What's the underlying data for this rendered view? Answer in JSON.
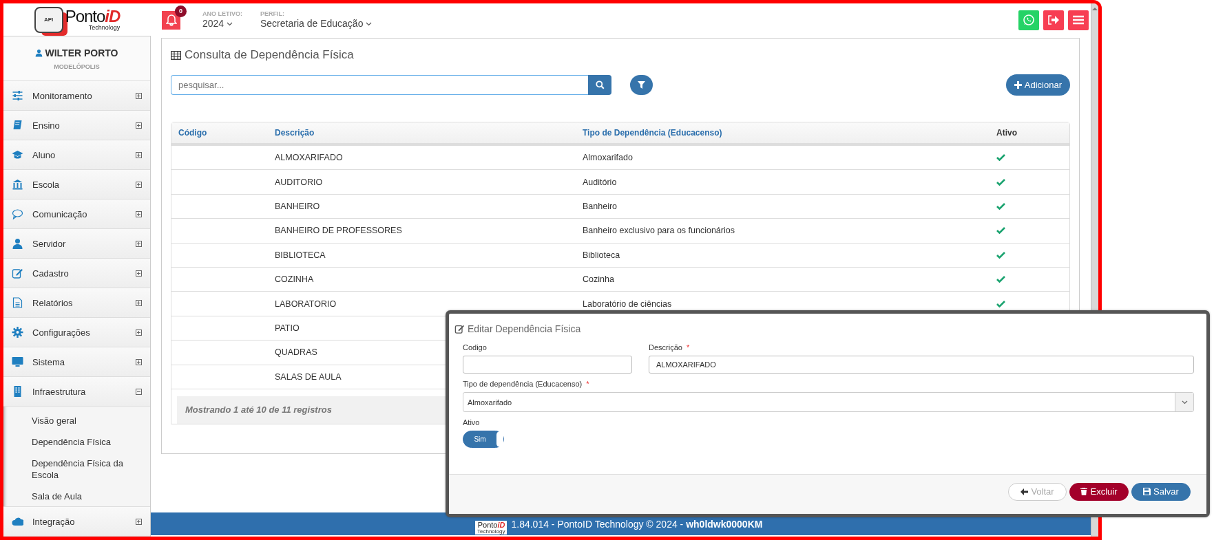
{
  "header": {
    "logo": {
      "badge": "API",
      "name": "Ponto",
      "accent": "iD",
      "tagline": "Technology"
    },
    "notifications": "0",
    "year": {
      "label": "ANO LETIVO:",
      "value": "2024"
    },
    "profile": {
      "label": "PERFIL:",
      "value": "Secretaria de Educação"
    }
  },
  "sidebar": {
    "user": "WILTER PORTO",
    "city": "MODELÓPOLIS",
    "items": [
      {
        "label": "Monitoramento",
        "expanded": false
      },
      {
        "label": "Ensino",
        "expanded": false
      },
      {
        "label": "Aluno",
        "expanded": false
      },
      {
        "label": "Escola",
        "expanded": false
      },
      {
        "label": "Comunicação",
        "expanded": false
      },
      {
        "label": "Servidor",
        "expanded": false
      },
      {
        "label": "Cadastro",
        "expanded": false
      },
      {
        "label": "Relatórios",
        "expanded": false
      },
      {
        "label": "Configurações",
        "expanded": false
      },
      {
        "label": "Sistema",
        "expanded": false
      },
      {
        "label": "Infraestrutura",
        "expanded": true,
        "children": [
          {
            "label": "Visão geral"
          },
          {
            "label": "Dependência Física"
          },
          {
            "label": "Dependência Física da Escola"
          },
          {
            "label": "Sala de Aula"
          }
        ]
      },
      {
        "label": "Integração",
        "expanded": false
      }
    ]
  },
  "page": {
    "title": "Consulta de Dependência Física",
    "search": {
      "placeholder": "pesquisar..."
    },
    "add_button": "Adicionar"
  },
  "table": {
    "columns": [
      "Código",
      "Descrição",
      "Tipo de Dependência (Educacenso)",
      "Ativo"
    ],
    "rows": [
      {
        "description": "ALMOXARIFADO",
        "type": "Almoxarifado",
        "active": true
      },
      {
        "description": "AUDITORIO",
        "type": "Auditório",
        "active": true
      },
      {
        "description": "BANHEIRO",
        "type": "Banheiro",
        "active": true
      },
      {
        "description": "BANHEIRO DE PROFESSORES",
        "type": "Banheiro exclusivo para os funcionários",
        "active": true
      },
      {
        "description": "BIBLIOTECA",
        "type": "Biblioteca",
        "active": true
      },
      {
        "description": "COZINHA",
        "type": "Cozinha",
        "active": true
      },
      {
        "description": "LABORATORIO",
        "type": "Laboratório de ciências",
        "active": true
      },
      {
        "description": "PATIO"
      },
      {
        "description": "QUADRAS"
      },
      {
        "description": "SALAS DE AULA"
      }
    ],
    "summary": "Mostrando **1** até **10** de **11** registros"
  },
  "footer": {
    "logo": {
      "name": "Ponto",
      "accent": "iD",
      "tagline": "Technology"
    },
    "text": "1.84.014 - PontoID Technology © 2024 - **wh0ldwk0000KM**"
  },
  "modal": {
    "title": "Editar Dependência Física",
    "fields": [
      {
        "kind": "text",
        "label": "Codigo"
      },
      {
        "kind": "text",
        "label": "Descrição",
        "mark": "*",
        "value": "ALMOXARIFADO"
      },
      {
        "kind": "select",
        "label": "Tipo de dependência (Educacenso)",
        "mark": "*",
        "value": "Almoxarifado"
      },
      {
        "kind": "toggle",
        "label": "Ativo",
        "on": true,
        "text": "Sim"
      }
    ],
    "buttons": [
      {
        "kind": "back",
        "label": "Voltar"
      },
      {
        "kind": "delete",
        "label": "Excluir"
      },
      {
        "kind": "save",
        "label": "Salvar"
      }
    ]
  }
}
